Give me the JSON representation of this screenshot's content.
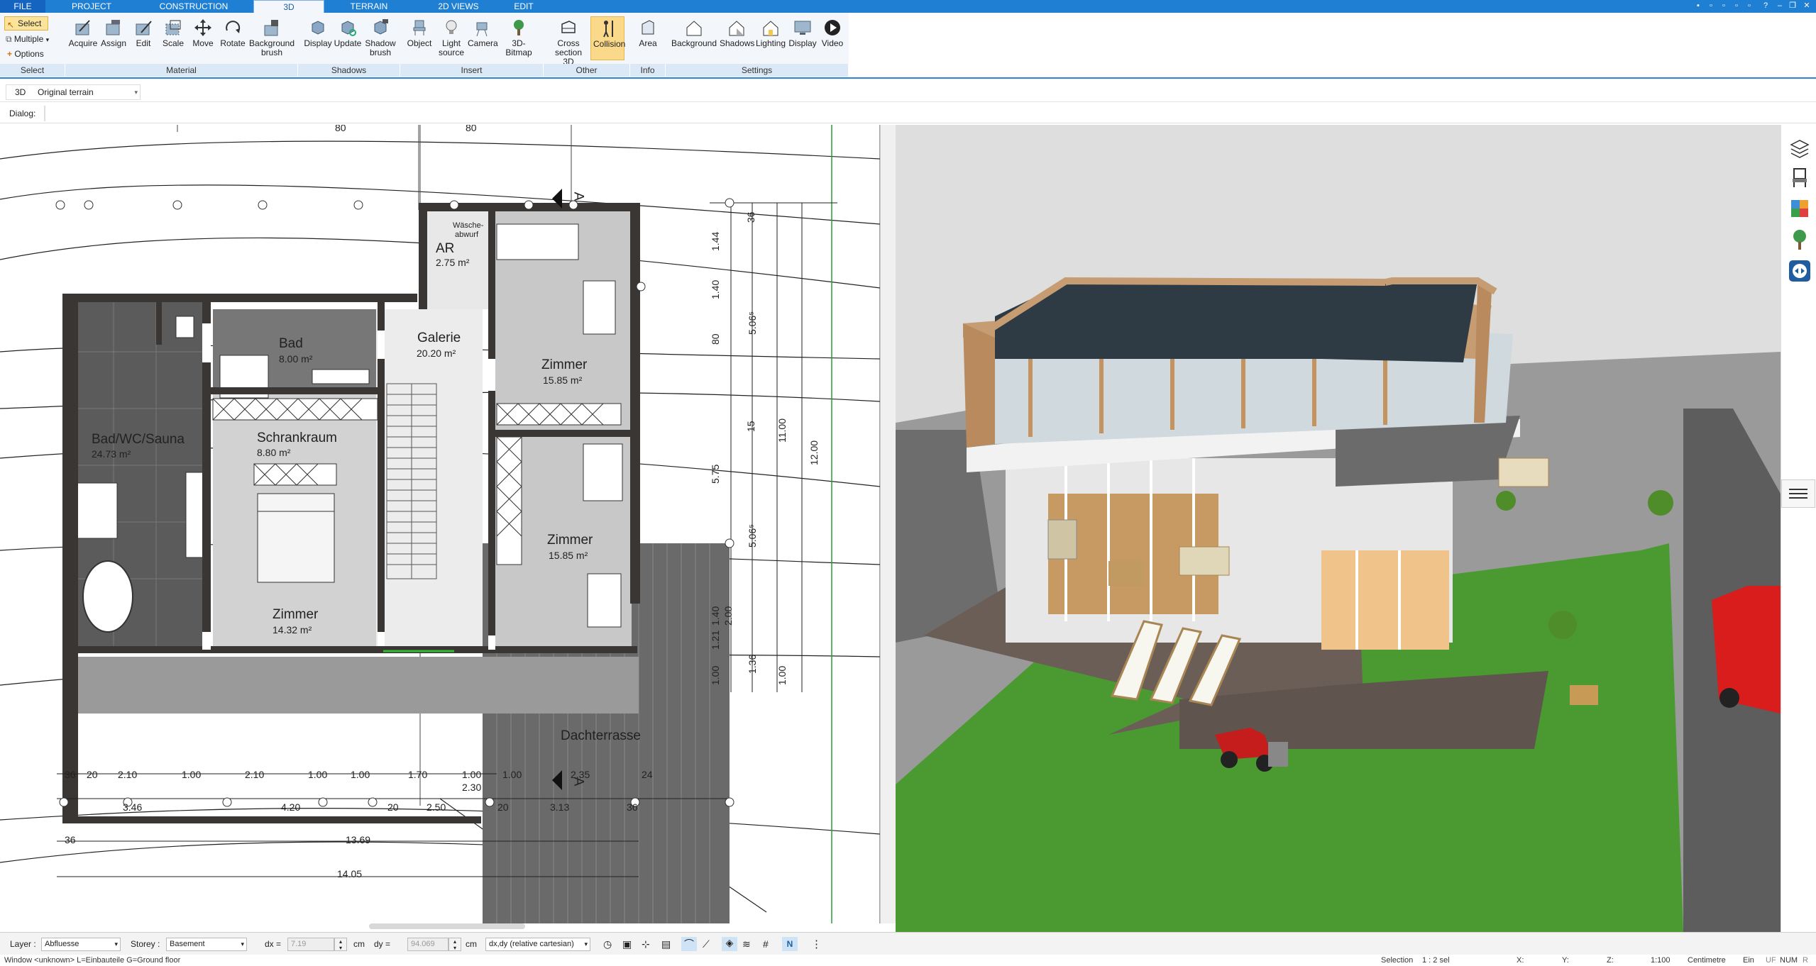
{
  "tabs": [
    {
      "label": "FILE"
    },
    {
      "label": "PROJECT"
    },
    {
      "label": "CONSTRUCTION"
    },
    {
      "label": "3D"
    },
    {
      "label": "TERRAIN"
    },
    {
      "label": "2D VIEWS"
    },
    {
      "label": "EDIT"
    }
  ],
  "ribbon": {
    "select": {
      "select_label": "Select",
      "multiple_label": "Multiple",
      "options_label": "Options",
      "group": "Select"
    },
    "material": {
      "group": "Material",
      "buttons": [
        "Acquire",
        "Assign",
        "Edit",
        "Scale",
        "Move",
        "Rotate",
        "Background brush"
      ]
    },
    "shadows": {
      "group": "Shadows",
      "buttons": [
        "Display",
        "Update",
        "Shadow brush"
      ]
    },
    "insert": {
      "group": "Insert",
      "buttons": [
        "Object",
        "Light source",
        "Camera",
        "3D-Bitmap"
      ]
    },
    "other": {
      "group": "Other",
      "buttons": [
        "Cross section 3D",
        "Collision"
      ]
    },
    "info": {
      "group": "Info",
      "buttons": [
        "Area"
      ]
    },
    "settings": {
      "group": "Settings",
      "buttons": [
        "Background",
        "Shadows",
        "Lighting",
        "Display",
        "Video"
      ]
    }
  },
  "view_row": {
    "mode": "3D",
    "terrain_select": "Original terrain"
  },
  "dialog_row": {
    "label": "Dialog:"
  },
  "plan": {
    "rooms": [
      {
        "name": "AR",
        "area": "2.75 m²"
      },
      {
        "name": "Wäsche-",
        "name2": "abwurf"
      },
      {
        "name": "Bad",
        "area": "8.00 m²"
      },
      {
        "name": "Galerie",
        "area": "20.20 m²"
      },
      {
        "name": "Zimmer",
        "area": "15.85 m²"
      },
      {
        "name": "Bad/WC/Sauna",
        "area": "24.73 m²"
      },
      {
        "name": "Schrankraum",
        "area": "8.80 m²"
      },
      {
        "name": "Zimmer",
        "area": "15.85 m²"
      },
      {
        "name": "Zimmer",
        "area": "14.32 m²"
      },
      {
        "name": "Dachterrasse"
      }
    ],
    "top_dims": [
      "80",
      "80"
    ],
    "section_marks": [
      "A",
      "A"
    ],
    "bottom_dims_row1": [
      "36",
      "20",
      "2.10",
      "1.00",
      "2.10",
      "1.00",
      "1.00",
      "1.70",
      "1.00",
      "1.00",
      "2.35",
      "24"
    ],
    "bottom_dims_row2": [
      "3.46",
      "4.20",
      "20",
      "2.50",
      "2.30",
      "20",
      "3.13",
      "36"
    ],
    "bottom_dims_row3": [
      "36",
      "13.69"
    ],
    "bottom_dims_row4": [
      "14.05"
    ],
    "right_dims": [
      "36",
      "1.44",
      "1.40",
      "80",
      "5.06⁵",
      "15",
      "11.00",
      "12.00",
      "5.75",
      "5.06⁵",
      "1.40",
      "2.00",
      "1.21",
      "1.36",
      "1.00",
      "1.00"
    ]
  },
  "status": {
    "layer_label": "Layer :",
    "layer_value": "Abfluesse",
    "storey_label": "Storey :",
    "storey_value": "Basement",
    "dx_label": "dx =",
    "dx_value": "7.19",
    "dx_unit": "cm",
    "dy_label": "dy =",
    "dy_value": "94.069",
    "dy_unit": "cm",
    "coord_mode": "dx,dy (relative cartesian)"
  },
  "bottom": {
    "window_text": "Window <unknown> L=Einbauteile G=Ground floor",
    "selection": "Selection",
    "sel_value": "1 : 2 sel",
    "x_label": "X:",
    "y_label": "Y:",
    "z_label": "Z:",
    "scale": "1:100",
    "unit": "Centimetre",
    "ein": "Ein",
    "uf": "UF",
    "num": "NUM",
    "r": "R"
  },
  "colors": {
    "accent": "#1f7fd3",
    "ribbon_bg": "#f3f6fa",
    "active_btn": "#fbd98a",
    "group_bar": "#dbe8f5"
  }
}
